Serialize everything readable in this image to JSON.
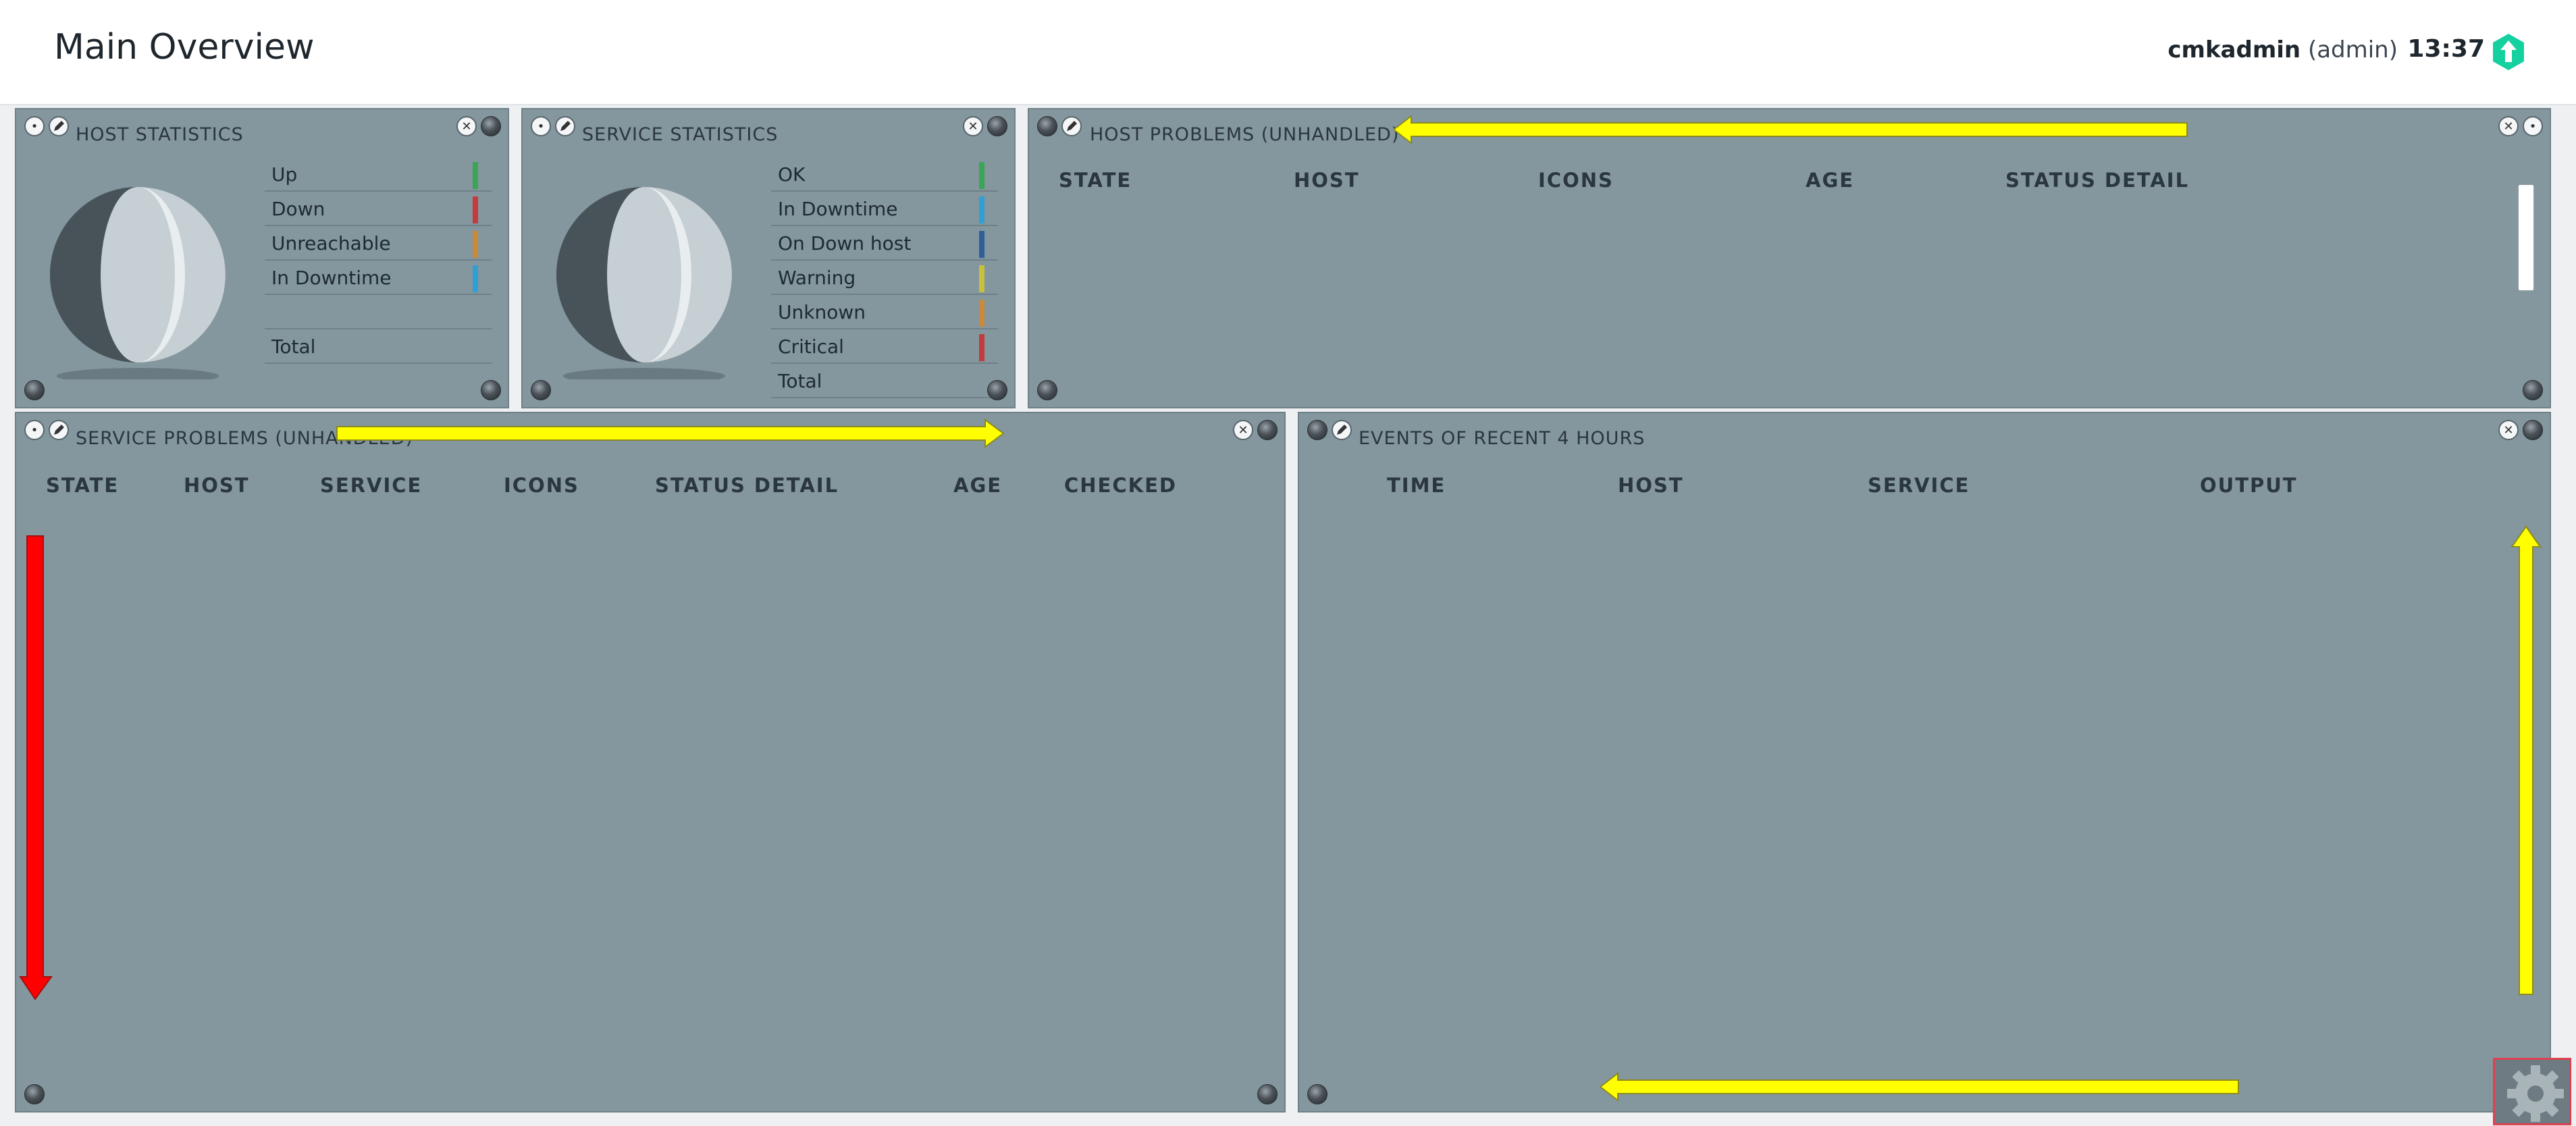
{
  "header": {
    "title": "Main Overview",
    "user": "cmkadmin",
    "role": "(admin)",
    "time": "13:37"
  },
  "host_stats": {
    "title": "HOST STATISTICS",
    "rows": [
      {
        "label": "Up",
        "color": "#3aa655"
      },
      {
        "label": "Down",
        "color": "#c43b3b"
      },
      {
        "label": "Unreachable",
        "color": "#c98a3a"
      },
      {
        "label": "In Downtime",
        "color": "#2f9fd6"
      },
      {
        "label": "",
        "color": ""
      },
      {
        "label": "Total",
        "color": ""
      }
    ]
  },
  "service_stats": {
    "title": "SERVICE STATISTICS",
    "rows": [
      {
        "label": "OK",
        "color": "#3aa655"
      },
      {
        "label": "In Downtime",
        "color": "#2f9fd6"
      },
      {
        "label": "On Down host",
        "color": "#2f5f9a"
      },
      {
        "label": "Warning",
        "color": "#c7c23a"
      },
      {
        "label": "Unknown",
        "color": "#c98a3a"
      },
      {
        "label": "Critical",
        "color": "#c43b3b"
      },
      {
        "label": "Total",
        "color": ""
      }
    ]
  },
  "host_problems": {
    "title": "HOST PROBLEMS (UNHANDLED)",
    "columns": [
      "STATE",
      "HOST",
      "ICONS",
      "AGE",
      "STATUS DETAIL"
    ]
  },
  "service_problems": {
    "title": "SERVICE PROBLEMS (UNHANDLED)",
    "columns": [
      "STATE",
      "HOST",
      "SERVICE",
      "ICONS",
      "STATUS DETAIL",
      "AGE",
      "CHECKED"
    ]
  },
  "events": {
    "title": "EVENTS OF RECENT 4 HOURS",
    "columns": [
      "TIME",
      "HOST",
      "SERVICE",
      "OUTPUT"
    ]
  },
  "colors": {
    "dashlet_bg": "#84969e",
    "arrow_yellow": "#ffff00",
    "arrow_red": "#ff0000",
    "logo_green": "#15d1a0"
  }
}
